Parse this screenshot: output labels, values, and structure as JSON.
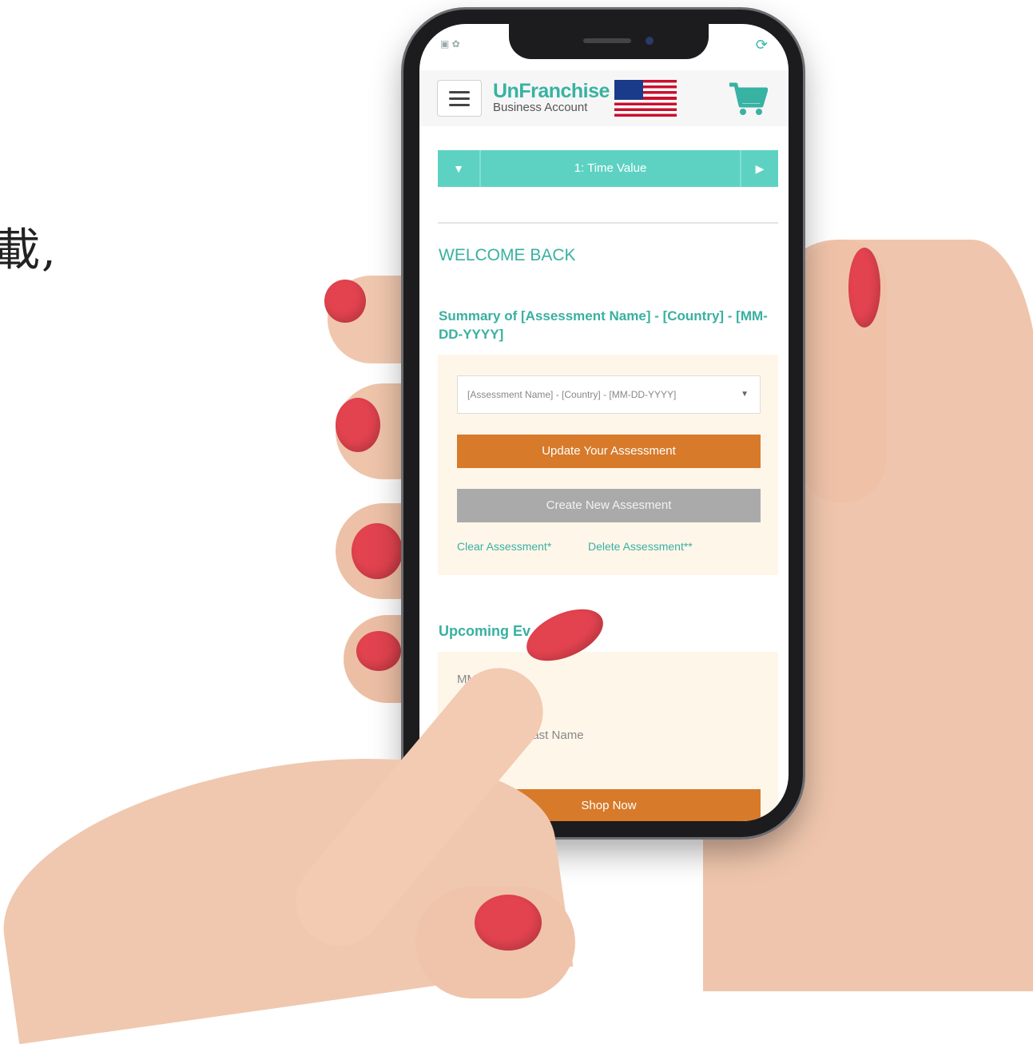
{
  "side_text": "載,",
  "app": {
    "brand_title": "UnFranchise",
    "brand_subtitle": "Business Account",
    "step_label": "1: Time Value",
    "welcome": "WELCOME BACK",
    "summary_title": "Summary of [Assessment Name] - [Country] - [MM-DD-YYYY]",
    "assessment_select": {
      "selected": "[Assessment Name] - [Country] - [MM-DD-YYYY]"
    },
    "update_button": "Update Your Assessment",
    "create_button": "Create New Assesment",
    "clear_link": "Clear Assessment*",
    "delete_link": "Delete Assessment**",
    "upcoming_title": "Upcoming Ev",
    "event_date": "MM",
    "event_name": "Last Name",
    "shop_button": "Shop Now"
  },
  "colors": {
    "teal": "#39b0a0",
    "stepper": "#5ed2c2",
    "orange": "#d77a2a",
    "gray_button": "#aaaaaa",
    "card_bg": "#fff6ea"
  },
  "icons": [
    "menu-icon",
    "us-flag-icon",
    "cart-icon",
    "chevron-down-icon",
    "chevron-right-icon"
  ]
}
